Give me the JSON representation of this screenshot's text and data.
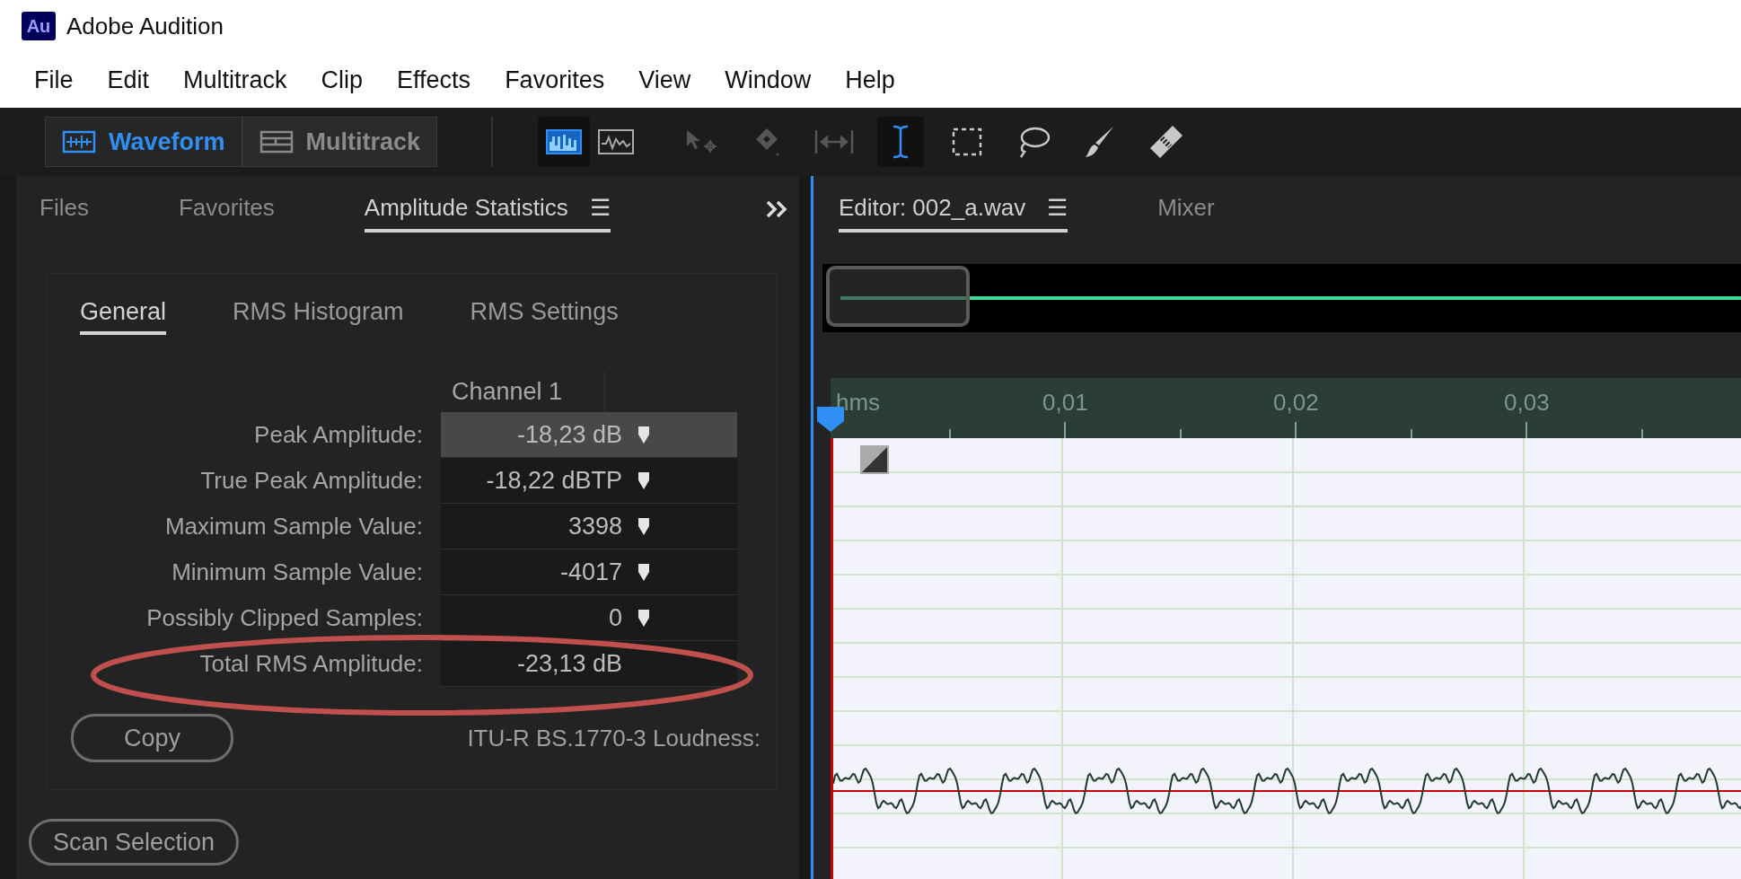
{
  "window": {
    "title": "Adobe Audition",
    "logo": "Au"
  },
  "menu": [
    "File",
    "Edit",
    "Multitrack",
    "Clip",
    "Effects",
    "Favorites",
    "View",
    "Window",
    "Help"
  ],
  "workspaces": [
    {
      "label": "Waveform",
      "kind": "waveform",
      "selected": true
    },
    {
      "label": "Multitrack",
      "kind": "multitrack",
      "selected": false
    }
  ],
  "view_buttons": [
    {
      "kind": "spectrum",
      "selected": true
    },
    {
      "kind": "waveform",
      "selected": false
    }
  ],
  "tools": [
    {
      "kind": "move",
      "selected": false,
      "disabled": true
    },
    {
      "kind": "razor",
      "selected": false,
      "disabled": true
    },
    {
      "kind": "slip",
      "selected": false,
      "disabled": true
    },
    {
      "kind": "time",
      "selected": true,
      "disabled": false
    },
    {
      "kind": "marquee",
      "selected": false,
      "disabled": false
    },
    {
      "kind": "lasso",
      "selected": false,
      "disabled": false
    },
    {
      "kind": "brush",
      "selected": false,
      "disabled": false
    },
    {
      "kind": "healing",
      "selected": false,
      "disabled": false
    }
  ],
  "panel_tabs": [
    {
      "label": "Files",
      "selected": false
    },
    {
      "label": "Favorites",
      "selected": false
    },
    {
      "label": "Amplitude Statistics",
      "selected": true,
      "menu": "☰"
    }
  ],
  "sub_tabs": [
    {
      "label": "General",
      "selected": true
    },
    {
      "label": "RMS Histogram",
      "selected": false
    },
    {
      "label": "RMS Settings",
      "selected": false
    }
  ],
  "stats": {
    "column": "Channel 1",
    "rows": [
      {
        "label": "Peak Amplitude:",
        "value": "-18,23 dB",
        "marker": true,
        "selected": true
      },
      {
        "label": "True Peak Amplitude:",
        "value": "-18,22 dBTP",
        "marker": true,
        "selected": false
      },
      {
        "label": "Maximum Sample Value:",
        "value": "3398",
        "marker": true,
        "selected": false
      },
      {
        "label": "Minimum Sample Value:",
        "value": "-4017",
        "marker": true,
        "selected": false
      },
      {
        "label": "Possibly Clipped Samples:",
        "value": "0",
        "marker": true,
        "selected": false
      },
      {
        "label": "Total RMS Amplitude:",
        "value": "-23,13 dB",
        "marker": false,
        "selected": false
      }
    ]
  },
  "copy_button": "Copy",
  "loudness_label": "ITU-R BS.1770-3 Loudness:",
  "scan_button": "Scan Selection",
  "editor_tabs": [
    {
      "label": "Editor: 002_a.wav",
      "selected": true,
      "menu": "☰"
    },
    {
      "label": "Mixer",
      "selected": false
    }
  ],
  "ruler": [
    "hms",
    "0,01",
    "0,02",
    "0,03"
  ]
}
